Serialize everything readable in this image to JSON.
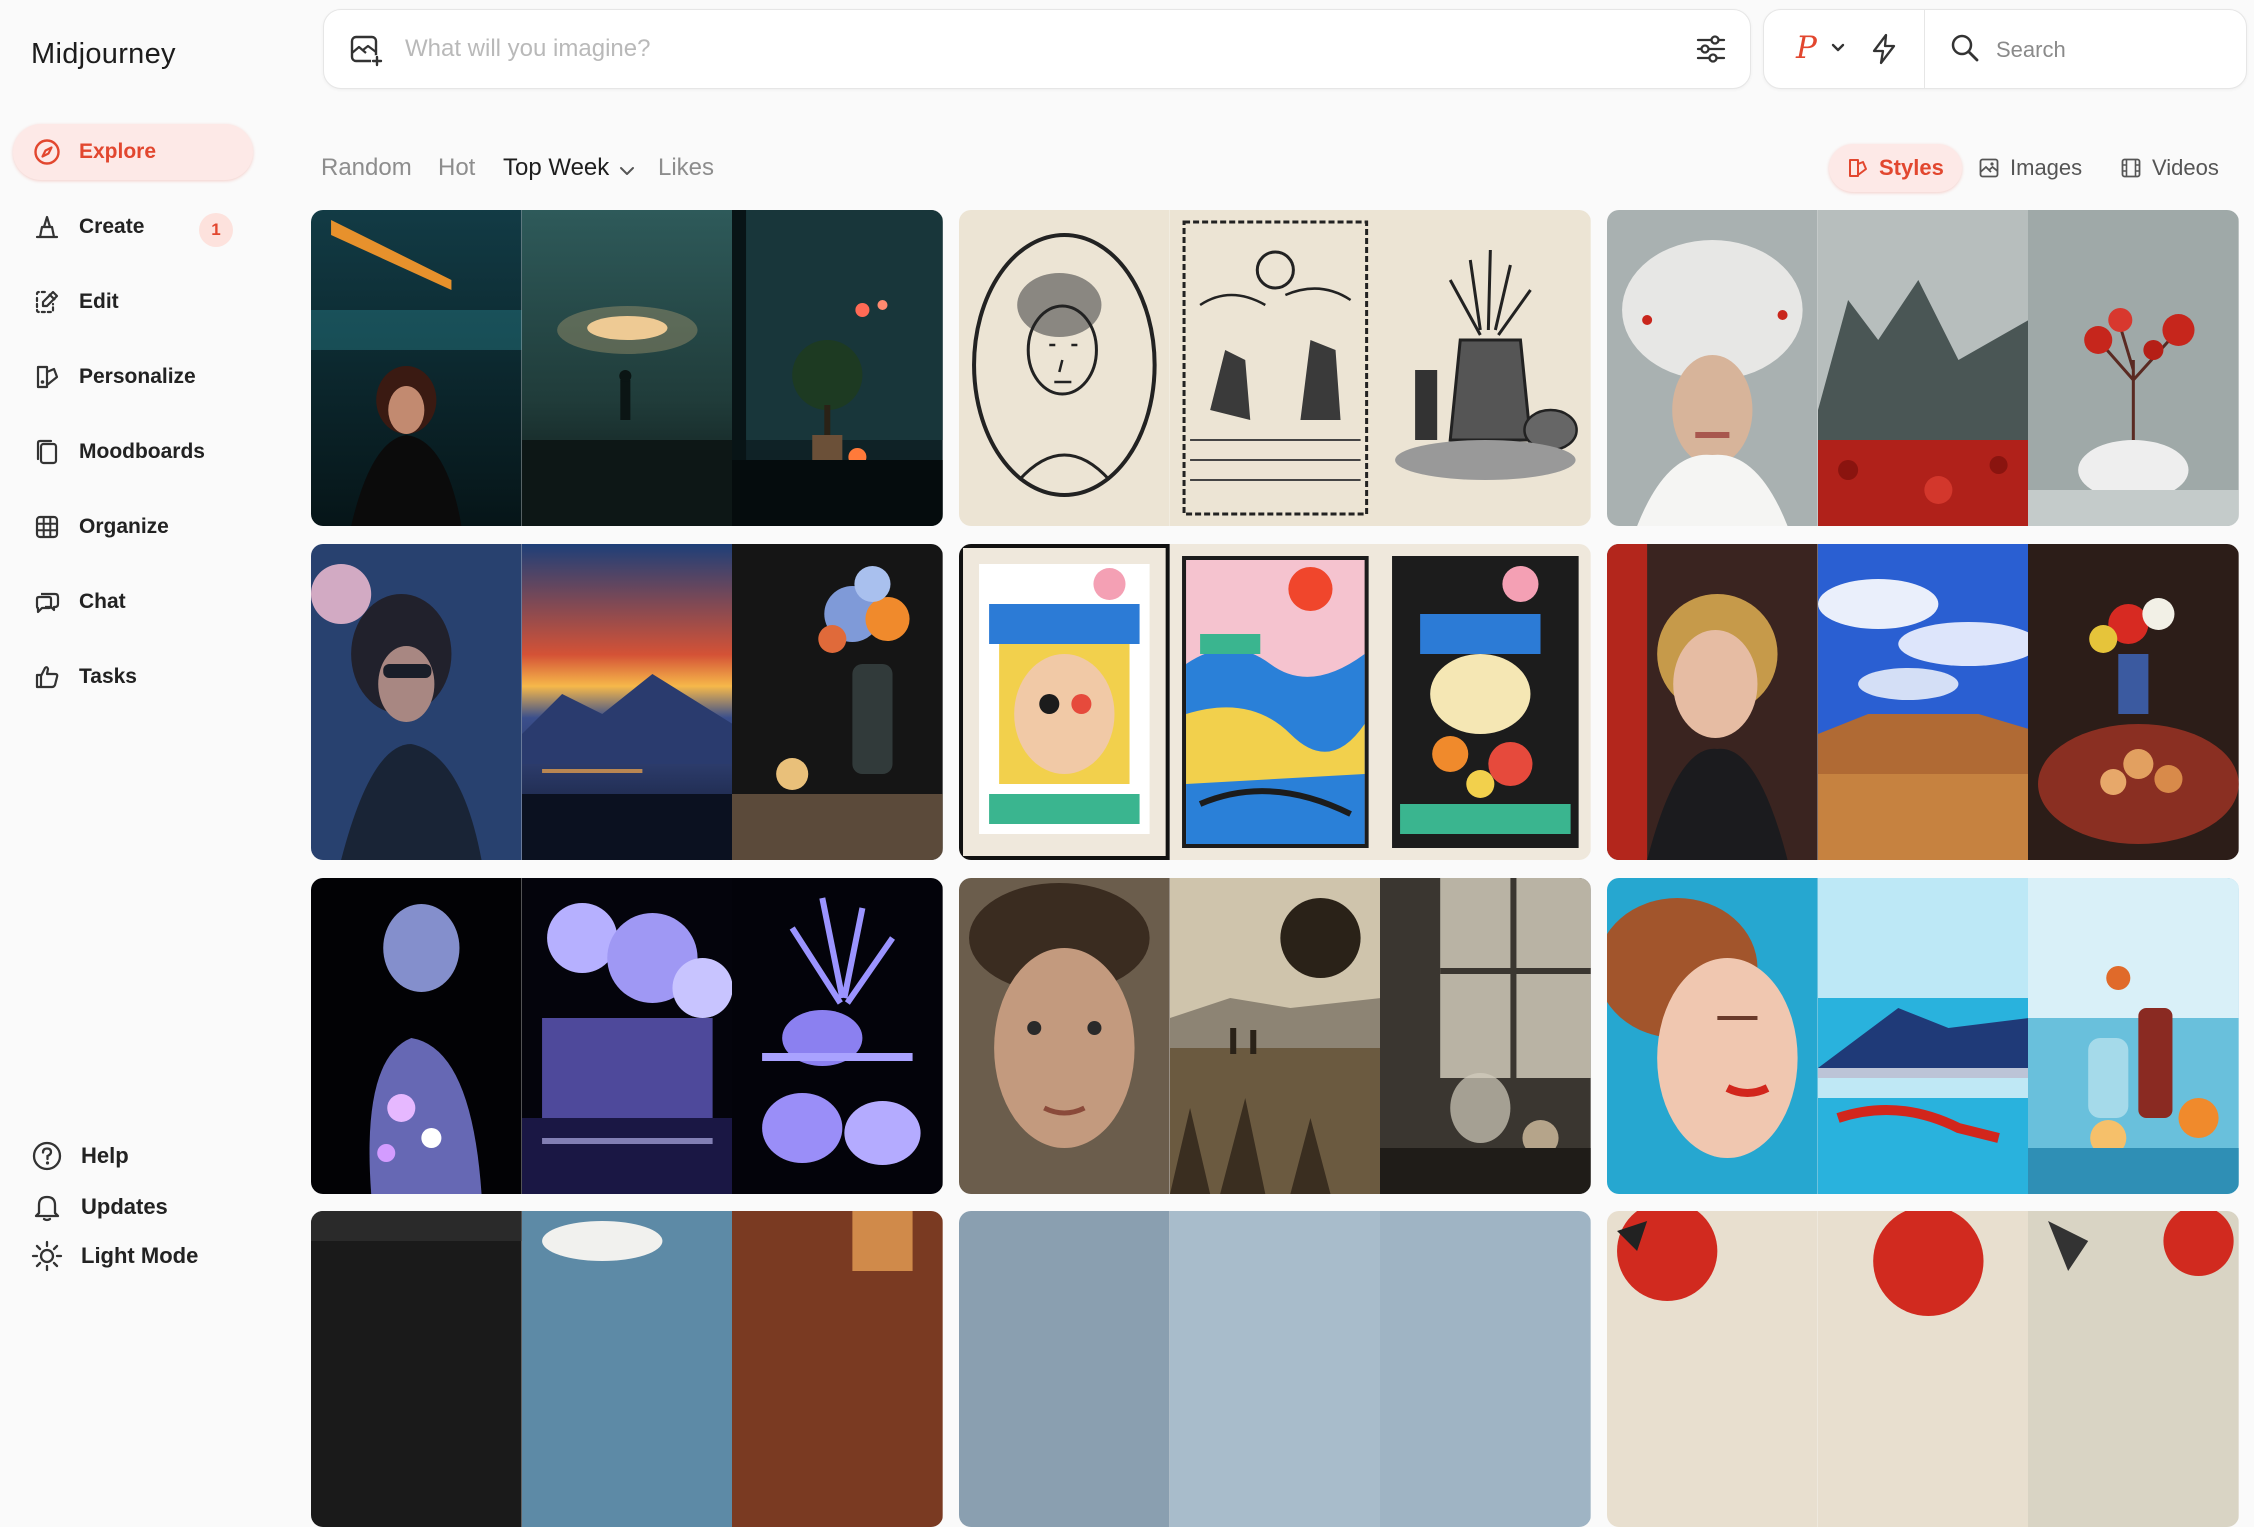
{
  "app": {
    "title": "Midjourney"
  },
  "sidebar": {
    "items": [
      {
        "label": "Explore",
        "icon": "compass-icon",
        "active": true
      },
      {
        "label": "Create",
        "icon": "brush-icon",
        "badge": "1"
      },
      {
        "label": "Edit",
        "icon": "edit-icon"
      },
      {
        "label": "Personalize",
        "icon": "personalize-icon"
      },
      {
        "label": "Moodboards",
        "icon": "moodboard-icon"
      },
      {
        "label": "Organize",
        "icon": "grid-icon"
      },
      {
        "label": "Chat",
        "icon": "chat-icon"
      },
      {
        "label": "Tasks",
        "icon": "thumbs-up-icon"
      }
    ],
    "footer": [
      {
        "label": "Help",
        "icon": "help-icon"
      },
      {
        "label": "Updates",
        "icon": "bell-icon"
      },
      {
        "label": "Light Mode",
        "icon": "sun-icon"
      }
    ]
  },
  "prompt": {
    "placeholder": "What will you imagine?"
  },
  "tools": {
    "profile_letter": "P",
    "search_placeholder": "Search"
  },
  "filters": {
    "sort": [
      {
        "label": "Random"
      },
      {
        "label": "Hot"
      },
      {
        "label": "Top Week",
        "active": true
      },
      {
        "label": "Likes"
      }
    ],
    "types": [
      {
        "label": "Styles",
        "icon": "style-icon",
        "active": true
      },
      {
        "label": "Images",
        "icon": "image-icon"
      },
      {
        "label": "Videos",
        "icon": "film-icon"
      }
    ]
  },
  "colors": {
    "accent": "#e2472f",
    "accent_bg": "#fde9e7"
  }
}
